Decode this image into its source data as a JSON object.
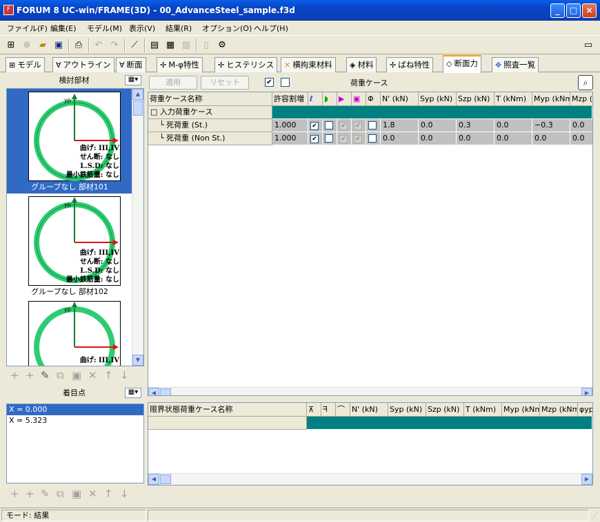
{
  "window": {
    "title": "FORUM 8  UC-win/FRAME(3D) - 00_AdvanceSteel_sample.f3d",
    "minimize": "_",
    "maximize": "□",
    "close": "×"
  },
  "menu": [
    "ファイル(F)",
    "編集(E)",
    "モデル(M)",
    "表示(V)",
    "結果(R)",
    "オプション(O)",
    "ヘルプ(H)"
  ],
  "tabs": [
    {
      "label": "モデル",
      "icon": "⊞"
    },
    {
      "label": "アウトライン",
      "icon": "∀"
    },
    {
      "label": "断面",
      "icon": "∀"
    },
    {
      "label": "M-φ特性",
      "icon": "✢"
    },
    {
      "label": "ヒステリシス",
      "icon": "✢"
    },
    {
      "label": "横拘束材料",
      "icon": "✕"
    },
    {
      "label": "材料",
      "icon": "◈"
    },
    {
      "label": "ばね特性",
      "icon": "✢"
    },
    {
      "label": "断面力",
      "icon": "◇"
    },
    {
      "label": "照査一覧",
      "icon": "✥"
    }
  ],
  "left": {
    "members_title": "検討部材",
    "members": [
      {
        "caption": "グループなし 部材101",
        "lines": [
          "曲げ: III,IV",
          "せん断: なし",
          "L.S.D: なし",
          "最小鉄筋量: なし"
        ]
      },
      {
        "caption": "グループなし 部材102",
        "lines": [
          "曲げ: III,IV",
          "せん断: なし",
          "L.S.D: なし",
          "最小鉄筋量: なし"
        ]
      },
      {
        "caption": "",
        "lines": [
          "曲げ: III,IV"
        ]
      }
    ],
    "axis_label": "yp",
    "points_title": "着目点",
    "points": [
      "X = 0.000",
      "X = 5.323"
    ]
  },
  "right": {
    "apply_label": "適用",
    "reset_label": "リセット",
    "loadcase_label": "荷重ケース",
    "grid1": {
      "headers": [
        "荷重ケース名称",
        "許容割増",
        "",
        "",
        "",
        "",
        "Φ",
        "N' (kN)",
        "Syp (kN)",
        "Szp (kN)",
        "T (kNm)",
        "Myp (kNm)",
        "Mzp (k"
      ],
      "group": "入力荷重ケース",
      "rows": [
        {
          "name": "死荷重 (St.)",
          "ratio": "1.000",
          "vals": [
            "1.8",
            "0.0",
            "0.3",
            "0.0",
            "−0.3",
            "0.0"
          ]
        },
        {
          "name": "死荷重 (Non St.)",
          "ratio": "1.000",
          "vals": [
            "0.0",
            "0.0",
            "0.0",
            "0.0",
            "0.0",
            "0.0"
          ]
        }
      ]
    },
    "grid2": {
      "headers": [
        "限界状態荷重ケース名称",
        "",
        "",
        "",
        "N' (kN)",
        "Syp (kN)",
        "Szp (kN)",
        "T (kNm)",
        "Myp (kNm)",
        "Mzp (kNm)",
        "φyp"
      ]
    }
  },
  "status": {
    "mode": "モード: 結果"
  },
  "colors": {
    "selection": "#316ac5",
    "teal": "#008080",
    "circle": "#2ecc71"
  }
}
